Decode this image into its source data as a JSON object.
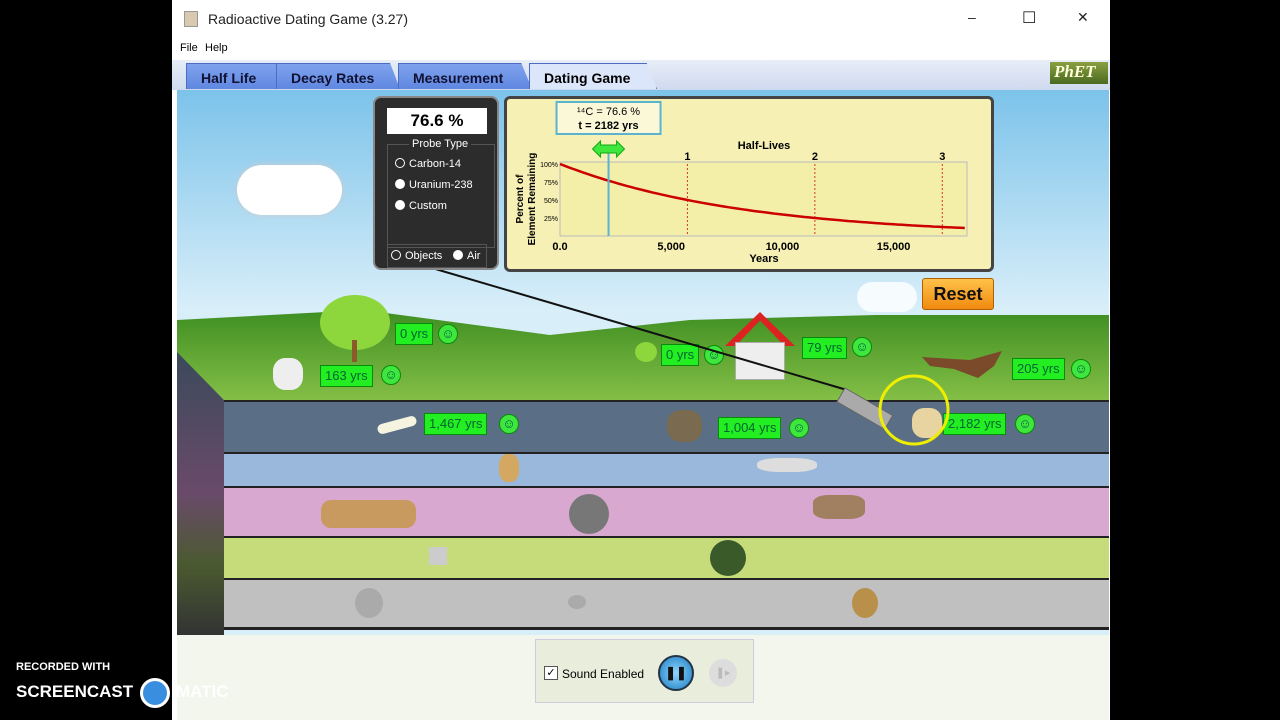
{
  "window": {
    "title": "Radioactive Dating Game (3.27)",
    "minimize": "–",
    "maximize": "☐",
    "close": "✕"
  },
  "menu": [
    "File",
    "Help"
  ],
  "tabs": [
    {
      "label": "Half Life"
    },
    {
      "label": "Decay Rates"
    },
    {
      "label": "Measurement"
    },
    {
      "label": "Dating Game",
      "active": true
    }
  ],
  "logo": "PhET",
  "probe": {
    "readout": "76.6 %",
    "probe_type_label": "Probe Type",
    "options": [
      {
        "label": "Carbon-14",
        "selected": false
      },
      {
        "label": "Uranium-238",
        "selected": true
      },
      {
        "label": "Custom",
        "selected": true
      }
    ],
    "mode_options": [
      {
        "label": "Objects",
        "selected": false
      },
      {
        "label": "Air",
        "selected": true
      }
    ]
  },
  "graph": {
    "tooltip_line1": "¹⁴C = 76.6 %",
    "tooltip_line2": "t = 2182 yrs",
    "half_lives_label": "Half-Lives",
    "half_life_ticks": [
      "1",
      "2",
      "3"
    ],
    "ylabel_line1": "Percent of",
    "ylabel_line2": "Element Remaining",
    "y_ticks": [
      "100%",
      "75%",
      "50%",
      "25%"
    ],
    "x_ticks": [
      "0.0",
      "5,000",
      "10,000",
      "15,000"
    ],
    "xlabel": "Years",
    "half_life_years": 5730,
    "current_years": 2182,
    "x_max": 18300,
    "curve_color": "#cc0000"
  },
  "reset_label": "Reset",
  "objects": [
    {
      "name": "tree",
      "age": "0 yrs"
    },
    {
      "name": "goat-skull",
      "age": "163 yrs"
    },
    {
      "name": "small-tree",
      "age": "0 yrs"
    },
    {
      "name": "house",
      "age": "79 yrs"
    },
    {
      "name": "dead-tree",
      "age": "205 yrs"
    },
    {
      "name": "bone",
      "age": "1,467 yrs"
    },
    {
      "name": "fish-fossil",
      "age": "1,004 yrs"
    },
    {
      "name": "skull",
      "age": "2,182 yrs"
    }
  ],
  "smile": "☺",
  "controls": {
    "sound_label": "Sound Enabled",
    "sound_checked": true,
    "pause": "❚❚",
    "step": "❚▸"
  },
  "watermark": {
    "line1": "RECORDED WITH",
    "line2": "SCREENCAST",
    "line3": "MATIC"
  }
}
